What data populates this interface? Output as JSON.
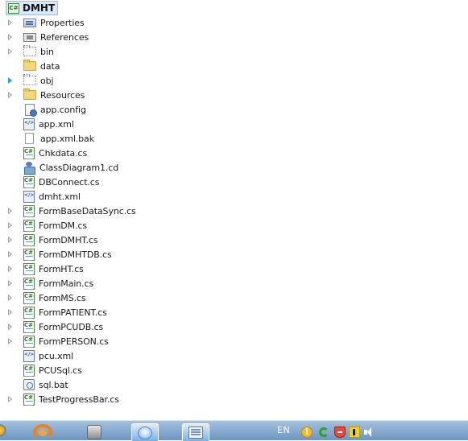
{
  "project": {
    "name": "DMHT"
  },
  "tree_items": [
    {
      "label": "Properties",
      "icon": "properties-icon",
      "expandable": true
    },
    {
      "label": "References",
      "icon": "references-icon",
      "expandable": true
    },
    {
      "label": "bin",
      "icon": "folder-empty-icon",
      "expandable": true
    },
    {
      "label": "data",
      "icon": "folder-icon",
      "expandable": false
    },
    {
      "label": "obj",
      "icon": "folder-empty-icon",
      "expandable": true,
      "active": true
    },
    {
      "label": "Resources",
      "icon": "folder-icon",
      "expandable": true
    },
    {
      "label": "app.config",
      "icon": "config-file-icon",
      "expandable": false
    },
    {
      "label": "app.xml",
      "icon": "xml-file-icon",
      "expandable": false
    },
    {
      "label": "app.xml.bak",
      "icon": "file-icon",
      "expandable": false
    },
    {
      "label": "Chkdata.cs",
      "icon": "csharp-file-icon",
      "expandable": false
    },
    {
      "label": "ClassDiagram1.cd",
      "icon": "class-diagram-icon",
      "expandable": false
    },
    {
      "label": "DBConnect.cs",
      "icon": "csharp-file-icon",
      "expandable": false
    },
    {
      "label": "dmht.xml",
      "icon": "xml-file-icon",
      "expandable": false
    },
    {
      "label": "FormBaseDataSync.cs",
      "icon": "csharp-file-icon",
      "expandable": true
    },
    {
      "label": "FormDM.cs",
      "icon": "csharp-file-icon",
      "expandable": true
    },
    {
      "label": "FormDMHT.cs",
      "icon": "csharp-file-icon",
      "expandable": true
    },
    {
      "label": "FormDMHTDB.cs",
      "icon": "csharp-file-icon",
      "expandable": true
    },
    {
      "label": "FormHT.cs",
      "icon": "csharp-file-icon",
      "expandable": true
    },
    {
      "label": "FormMain.cs",
      "icon": "csharp-file-icon",
      "expandable": true
    },
    {
      "label": "FormMS.cs",
      "icon": "csharp-file-icon",
      "expandable": true
    },
    {
      "label": "FormPATIENT.cs",
      "icon": "csharp-file-icon",
      "expandable": true
    },
    {
      "label": "FormPCUDB.cs",
      "icon": "csharp-file-icon",
      "expandable": true
    },
    {
      "label": "FormPERSON.cs",
      "icon": "csharp-file-icon",
      "expandable": true
    },
    {
      "label": "pcu.xml",
      "icon": "xml-file-icon",
      "expandable": false
    },
    {
      "label": "PCUSql.cs",
      "icon": "csharp-file-icon",
      "expandable": false
    },
    {
      "label": "sql.bat",
      "icon": "batch-file-icon",
      "expandable": false
    },
    {
      "label": "TestProgressBar.cs",
      "icon": "csharp-file-icon",
      "expandable": true
    }
  ],
  "taskbar": {
    "language": "EN",
    "apps": [
      "start-orb-icon",
      "browser-icon",
      "app-icon",
      "network-app-icon",
      "document-app-icon"
    ],
    "tray_icons": [
      "info-icon",
      "green-circle-icon",
      "shield-icon",
      "yellow-app-icon",
      "volume-icon"
    ]
  },
  "colors": {
    "selection_fill": "#dbe8fa",
    "selection_border": "#9bbbe3",
    "active_arrow": "#1ea0f0",
    "taskbar_top": "#a5c2de",
    "taskbar_bottom": "#6d95c2"
  }
}
